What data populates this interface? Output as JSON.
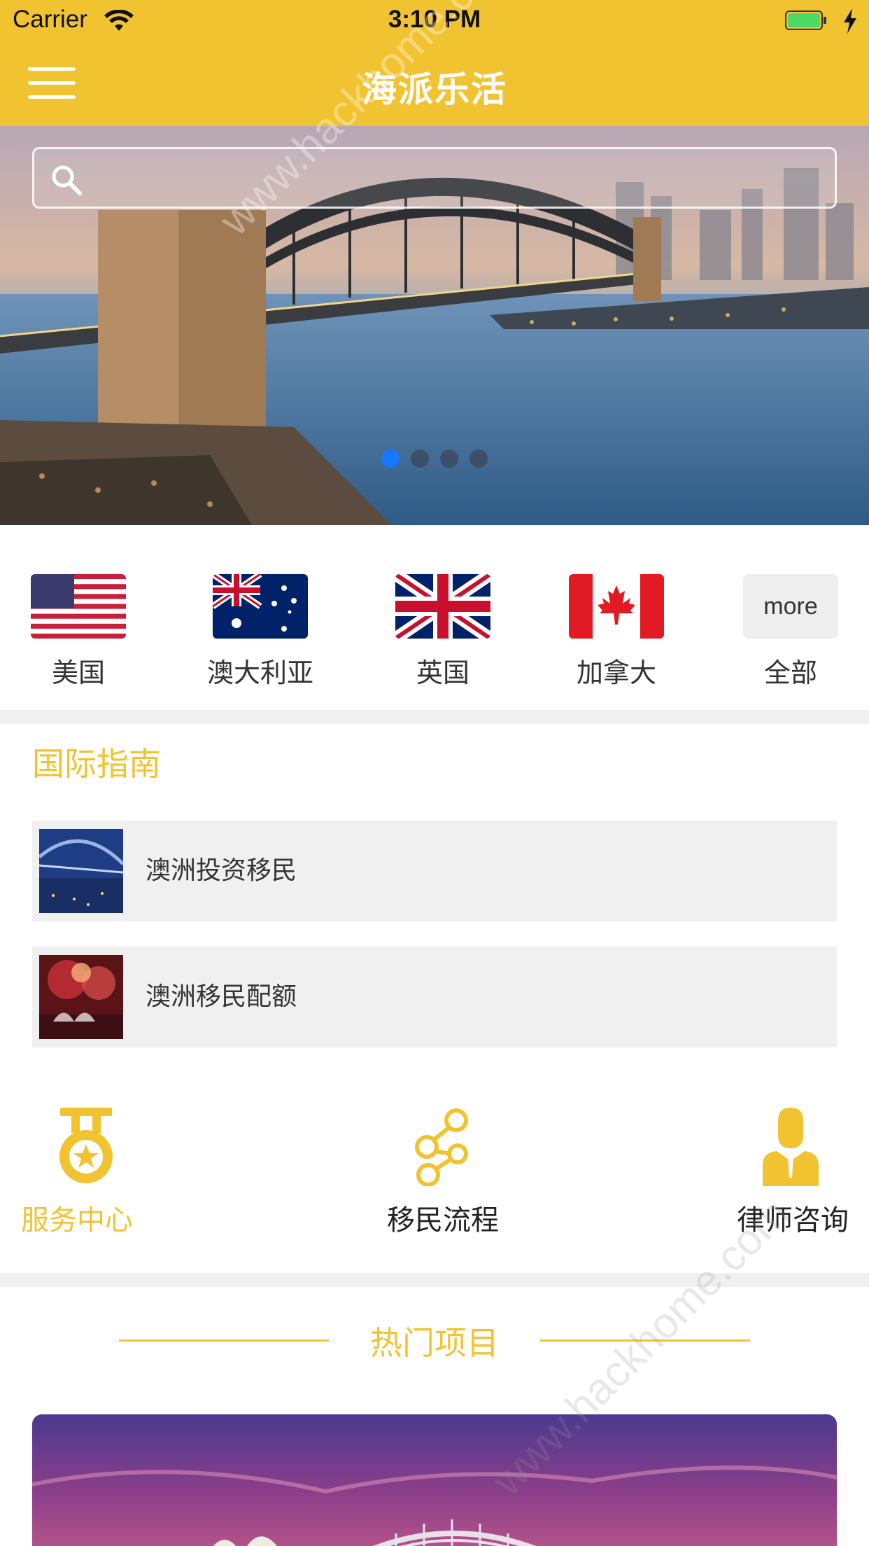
{
  "status_bar": {
    "carrier": "Carrier",
    "time": "3:10 PM",
    "wifi_icon": "wifi-icon",
    "battery_icon": "battery-icon",
    "charging_icon": "charging-bolt-icon"
  },
  "nav": {
    "title": "海派乐活",
    "menu_icon": "hamburger-menu-icon"
  },
  "banner": {
    "search_icon": "search-icon",
    "search_placeholder": "",
    "page_count": 4,
    "active_page": 1
  },
  "countries": [
    {
      "label": "美国",
      "flag": "us-flag-icon"
    },
    {
      "label": "澳大利亚",
      "flag": "australia-flag-icon"
    },
    {
      "label": "英国",
      "flag": "uk-flag-icon"
    },
    {
      "label": "加拿大",
      "flag": "canada-flag-icon"
    },
    {
      "label": "全部",
      "more_text": "more"
    }
  ],
  "guide": {
    "title": "国际指南",
    "items": [
      {
        "label": "澳洲投资移民",
        "thumb": "harbour-bridge-thumbnail"
      },
      {
        "label": "澳洲移民配额",
        "thumb": "fireworks-thumbnail"
      }
    ]
  },
  "services": [
    {
      "label": "服务中心",
      "icon": "medal-icon",
      "active": true
    },
    {
      "label": "移民流程",
      "icon": "process-nodes-icon",
      "active": false
    },
    {
      "label": "律师咨询",
      "icon": "lawyer-person-icon",
      "active": false
    }
  ],
  "hot": {
    "title": "热门项目"
  },
  "watermark": {
    "text": "www.hackhome.com"
  },
  "colors": {
    "brand_yellow": "#f2c331",
    "active_dot": "#1677ff",
    "item_bg": "#f0f0f0"
  }
}
